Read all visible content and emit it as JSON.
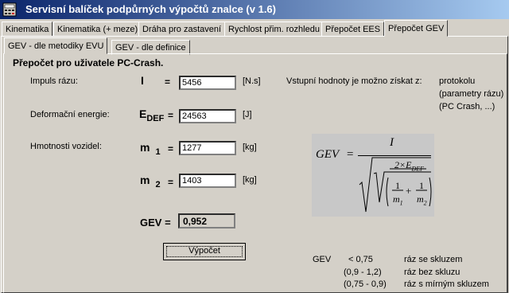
{
  "window": {
    "title": "Servisní balíček podpůrných výpočtů znalce (v 1.6)"
  },
  "tabs": [
    {
      "label": "Kinematika"
    },
    {
      "label": "Kinematika (+ meze)"
    },
    {
      "label": "Dráha pro zastavení"
    },
    {
      "label": "Rychlost přim. rozhledu"
    },
    {
      "label": "Přepočet EES"
    },
    {
      "label": "Přepočet GEV"
    }
  ],
  "subtabs": [
    {
      "label": "GEV - dle metodiky EVU"
    },
    {
      "label": "GEV - dle definice"
    }
  ],
  "section": {
    "title": "Přepočet pro uživatele PC-Crash."
  },
  "fields": {
    "impulse": {
      "label": "Impuls rázu:",
      "symbol": "I",
      "eq": "=",
      "value": "5456",
      "unit": "[N.s]"
    },
    "energy": {
      "label": "Deformační energie:",
      "symbol_main": "E",
      "symbol_sub": "DEF",
      "eq": "=",
      "value": "24563",
      "unit": "[J]"
    },
    "mass_label": "Hmotnosti vozidel:",
    "m1": {
      "symbol_main": "m",
      "symbol_sub": "1",
      "eq": "=",
      "value": "1277",
      "unit": "[kg]"
    },
    "m2": {
      "symbol_main": "m",
      "symbol_sub": "2",
      "eq": "=",
      "value": "1403",
      "unit": "[kg]"
    }
  },
  "result": {
    "label": "GEV =",
    "value": "0,952"
  },
  "button": {
    "label": "Výpočet"
  },
  "info": {
    "text": "Vstupní hodnoty je možno získat z:",
    "lines": [
      "protokolu",
      "(parametry rázu)",
      "(PC Crash, ...)"
    ]
  },
  "formula": {
    "lhs": "GEV",
    "eq": "=",
    "numerator": "I",
    "inner_num": "2×E",
    "inner_sub": "DEF",
    "one": "1",
    "plus": "+",
    "m_sym": "m",
    "sub1": "1",
    "sub2": "2"
  },
  "legend": {
    "label": "GEV",
    "rows": [
      {
        "range": "< 0,75",
        "desc": "ráz se skluzem"
      },
      {
        "range": "(0,9 - 1,2)",
        "desc": "ráz bez skluzu"
      },
      {
        "range": "(0,75 - 0,9)",
        "desc": "ráz s mírným skluzem"
      }
    ]
  },
  "colors": {
    "title_start": "#0a246a",
    "title_end": "#a6caf0",
    "face": "#d4d0c8",
    "formula_bg": "#c8c8c8"
  }
}
